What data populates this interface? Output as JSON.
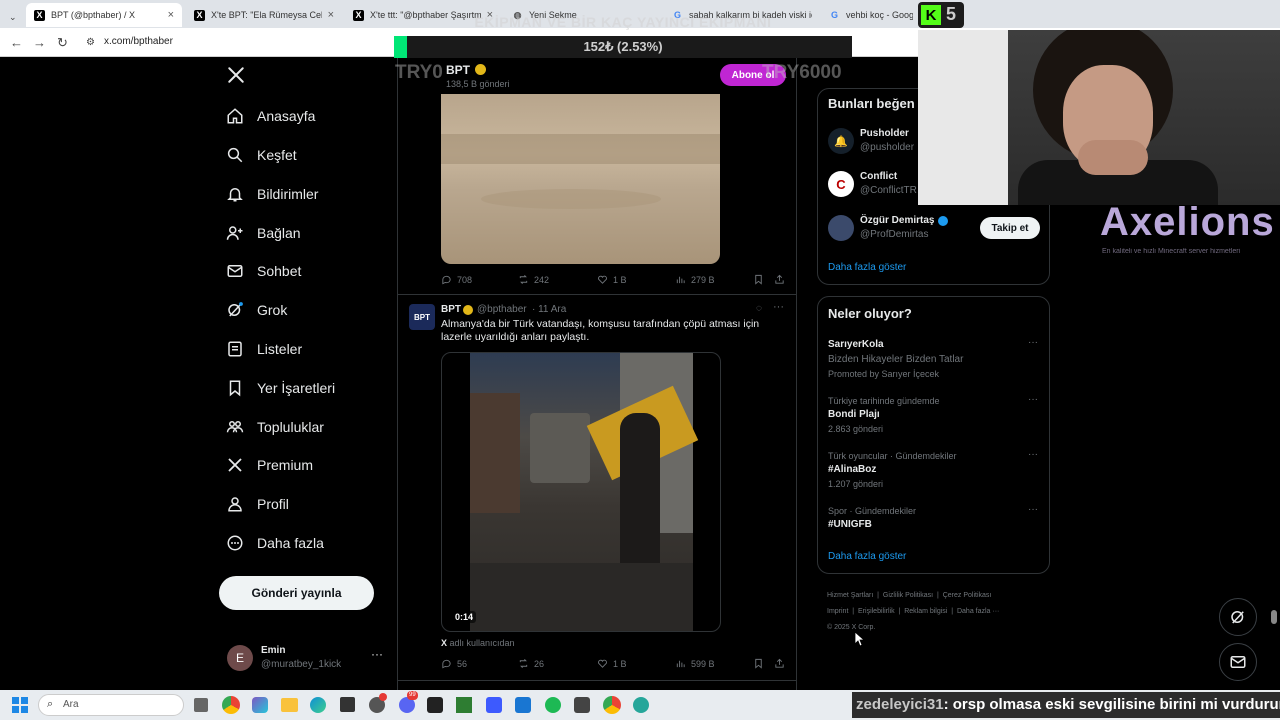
{
  "browser": {
    "tabs": [
      {
        "title": "BPT (@bpthaber) / X",
        "icon": "x-logo-icon",
        "active": true
      },
      {
        "title": "X'te BPT: \"Ela Rümeysa Cebeci",
        "icon": "x-logo-icon"
      },
      {
        "title": "X'te ttt: \"@bpthaber Şaşırtmadı",
        "icon": "x-logo-icon"
      },
      {
        "title": "Yeni Sekme",
        "icon": "globe-icon"
      },
      {
        "title": "sabah kalkarım bi kadeh viski iç",
        "icon": "google-icon"
      },
      {
        "title": "vehbi koç - Google'da",
        "icon": "google-icon"
      }
    ],
    "url": "x.com/bpthaber"
  },
  "sidebar": {
    "items": [
      {
        "label": "Anasayfa",
        "icon": "home-icon"
      },
      {
        "label": "Keşfet",
        "icon": "search-icon"
      },
      {
        "label": "Bildirimler",
        "icon": "bell-icon"
      },
      {
        "label": "Bağlan",
        "icon": "add-person-icon"
      },
      {
        "label": "Sohbet",
        "icon": "mail-icon"
      },
      {
        "label": "Grok",
        "icon": "grok-icon"
      },
      {
        "label": "Listeler",
        "icon": "list-icon"
      },
      {
        "label": "Yer İşaretleri",
        "icon": "bookmark-icon"
      },
      {
        "label": "Topluluklar",
        "icon": "communities-icon"
      },
      {
        "label": "Premium",
        "icon": "x-logo-icon"
      },
      {
        "label": "Profil",
        "icon": "person-icon"
      },
      {
        "label": "Daha fazla",
        "icon": "more-circle-icon"
      }
    ],
    "post_button": "Gönderi yayınla",
    "account": {
      "name": "Emin",
      "handle": "@muratbey_1kick",
      "initial": "E"
    }
  },
  "profile_header": {
    "name": "BPT",
    "posts": "138,5 B gönderi",
    "subscribe": "Abone ol"
  },
  "posts": [
    {
      "replies": "708",
      "reposts": "242",
      "likes": "1 B",
      "views": "279 B"
    },
    {
      "avatar": "BPT",
      "name": "BPT",
      "handle": "@bpthaber",
      "date": "· 11 Ara",
      "text": "Almanya'da bir Türk vatandaşı, komşusu tarafından çöpü atması için lazerle uyarıldığı anları paylaştı.",
      "video_time": "0:14",
      "source_x": "X",
      "source_text": " adlı kullanıcıdan",
      "replies": "56",
      "reposts": "26",
      "likes": "1 B",
      "views": "599 B"
    }
  ],
  "who_to_follow": {
    "title": "Bunları beğen",
    "accounts": [
      {
        "name": "Pusholder",
        "handle": "@pusholder"
      },
      {
        "name": "Conflict",
        "handle": "@ConflictTR"
      },
      {
        "name": "Özgür Demirtaş",
        "handle": "@ProfDemirtas",
        "button": "Takip et"
      }
    ],
    "more": "Daha fazla göster"
  },
  "trends": {
    "title": "Neler oluyor?",
    "items": [
      {
        "context": "",
        "name": "SarıyerKola",
        "sub": "Bizden Hikayeler Bizden Tatlar",
        "meta": "Promoted by Sarıyer İçecek"
      },
      {
        "context": "Türkiye tarihinde gündemde",
        "name": "Bondi Plajı",
        "sub": "",
        "meta": "2.863 gönderi"
      },
      {
        "context": "Türk oyuncular · Gündemdekiler",
        "name": "#AlinaBoz",
        "sub": "",
        "meta": "1.207 gönderi"
      },
      {
        "context": "Spor · Gündemdekiler",
        "name": "#UNIGFB",
        "sub": "",
        "meta": ""
      }
    ],
    "more": "Daha fazla göster"
  },
  "footer": {
    "links": [
      "Hizmet Şartları",
      "Gizlilik Politikası",
      "Çerez Politikası",
      "Imprint",
      "Erişilebilirlik",
      "Reklam bilgisi",
      "Daha fazla ···"
    ],
    "copyright": "© 2025 X Corp."
  },
  "overlay": {
    "goal_title": "EKİPMAN VE BİR KAÇ YAYINCI EKİPMANI",
    "goal_amount": "152₺ (2.53%)",
    "goal_progress": 0.0253,
    "goal_left": "TRY0",
    "goal_right": "TRY6000",
    "kick_count": "5",
    "brand": "Axelions",
    "brand_sub": "En kaliteli ve hızlı Minecraft server hizmetleri",
    "chat_user": "zedeleyici31",
    "chat_msg": ": orsp olmasa eski sevgilisine birini mi vurdurur"
  },
  "taskbar": {
    "search_placeholder": "Ara",
    "notif_badge": "99"
  }
}
